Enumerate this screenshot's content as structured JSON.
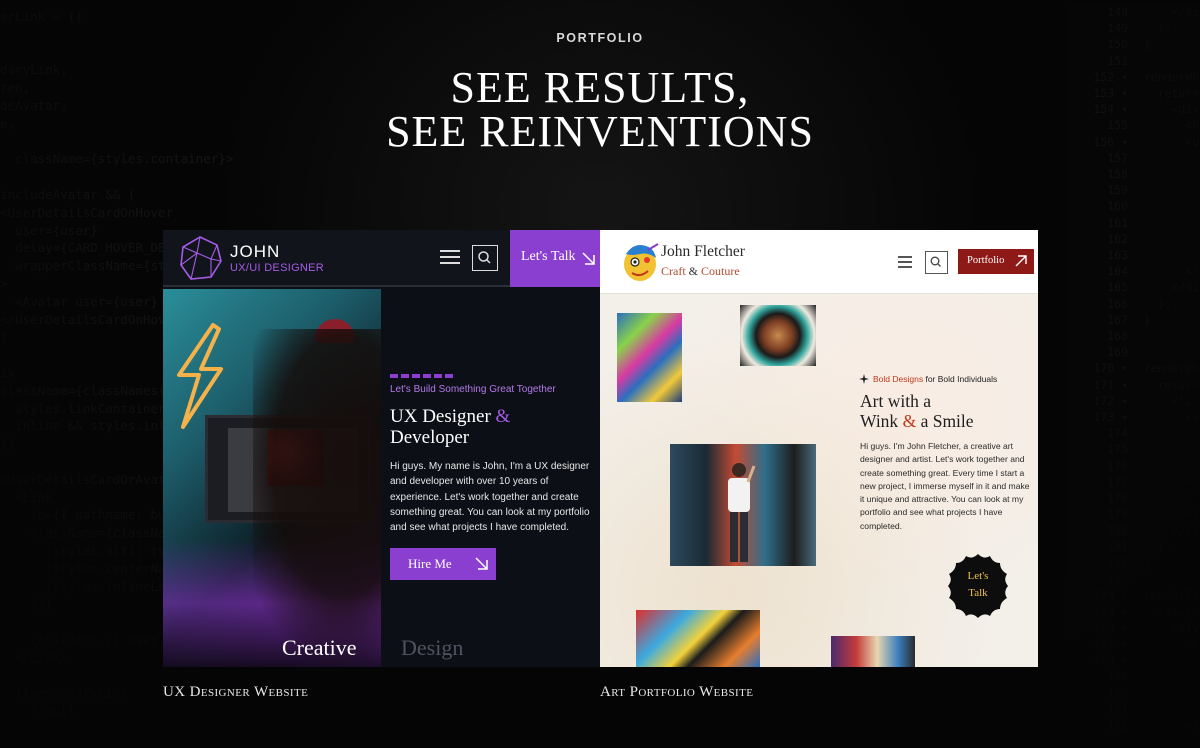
{
  "background_code": {
    "left_lines": [
      "erLink = ({",
      "",
      "",
      "daryLink,",
      "ren,",
      "deAvatar,",
      "e,",
      "",
      "  className={styles.container}>",
      "",
      "includeAvatar && (",
      "<UserDetailsCardOnHover",
      "  user={user}",
      "  delay={CARD_HOVER_DE",
      "  wrapperClassName={st",
      ">",
      "  <Avatar user={user}",
      "</UserDetailsCardOnHove",
      ")",
      "",
      "iv",
      "className={classNames(",
      "  styles.linkContainer,",
      "  inline && styles.inli",
      "}}",
      "",
      "<UserDetailsCardOrAvat",
      "  <Link",
      "    to={{ pathname: bui",
      "    className={classNam",
      "      [styles.alt]: typ",
      "      [styles.centerNa",
      "      [styles.inlineLi",
      "    }}}",
      "",
      "    {children || user.n",
      "  </Link>",
      "",
      "  {|secondaryLink",
      "    ? null"
    ],
    "gutter_lines": [
      "148",
      "149",
      "150",
      "151",
      "152 ▾",
      "153 ▾",
      "154 ▾",
      "155",
      "156 ▾",
      "157",
      "158",
      "159",
      "160",
      "161",
      "162",
      "163",
      "164",
      "165",
      "166",
      "167",
      "168",
      "169",
      "170 ▾",
      "171 ▾",
      "172 ▾",
      "173 ▾",
      "174",
      "175",
      "176",
      "177",
      "178",
      "179",
      "180",
      "181",
      "182",
      "183",
      "184 ▾",
      "185 ▾",
      "186 ▾",
      "187 ▾",
      "188 ▾",
      "189",
      "190",
      "191",
      "192"
    ],
    "right_lines": [
      "      </div>",
      "    );",
      "  }",
      "",
      "  renderWhats",
      "    return (",
      "      <div cl",
      "        <h4 c",
      "        <ul c",
      "          {th",
      "          {th",
      "          {th",
      "          {th",
      "          {th",
      "          {th",
      "          {th",
      "        </ul>",
      "      </div>",
      "    );",
      "  }",
      "",
      "",
      "  renderWhats",
      "    return (",
      "      <li cla",
      "        <a",
      "          hre",
      "          targ",
      "          rel",
      "        >",
      "          {tit",
      "        </a>",
      "      </li>",
      "    );",
      "  }",
      "",
      "  renderFooter",
      "    return (",
      "      <div cl",
      "        <Link",
      "          <Ico",
      "            t",
      "            c",
      "          />",
      "        </Lin"
    ]
  },
  "header": {
    "eyebrow": "PORTFOLIO",
    "headline_line1": "SEE RESULTS,",
    "headline_line2": "SEE REINVENTIONS"
  },
  "ux_card": {
    "nav": {
      "name": "JOHN",
      "role": "UX/UI DESIGNER",
      "cta": "Let's Talk"
    },
    "tagline": "Let's Build Something Great Together",
    "title_part1": "UX Designer",
    "title_amp": "&",
    "title_part2": "Developer",
    "body": "Hi guys. My name is John, I'm a UX designer and developer with over 10 years of experience. Let's work together and create something great. You can look at my portfolio and see what projects I have completed.",
    "hire_button": "Hire Me",
    "bottom_word1": "Creative",
    "bottom_word2": "Design",
    "accent_color": "#8b3fd0"
  },
  "art_card": {
    "nav": {
      "name": "John Fletcher",
      "sub_part1": "Craft",
      "sub_amp": "&",
      "sub_part2": "Couture",
      "cta": "Portfolio"
    },
    "tag_red": "Bold Designs",
    "tag_rest": "for Bold Individuals",
    "title_line1": "Art with a",
    "title_part2a": "Wink",
    "title_amp": "&",
    "title_part2b": "a Smile",
    "body": "Hi guys. I'm John Fletcher, a creative art designer and artist. Let's work together and create something great. Every time I start a new project, I immerse myself in it and make it unique and attractive. You can look at my portfolio and see what projects I have completed.",
    "badge_line1": "Let's",
    "badge_line2": "Talk",
    "accent_color": "#8d1a17"
  },
  "captions": {
    "ux": "UX Designer Website",
    "art": "Art Portfolio Website"
  }
}
